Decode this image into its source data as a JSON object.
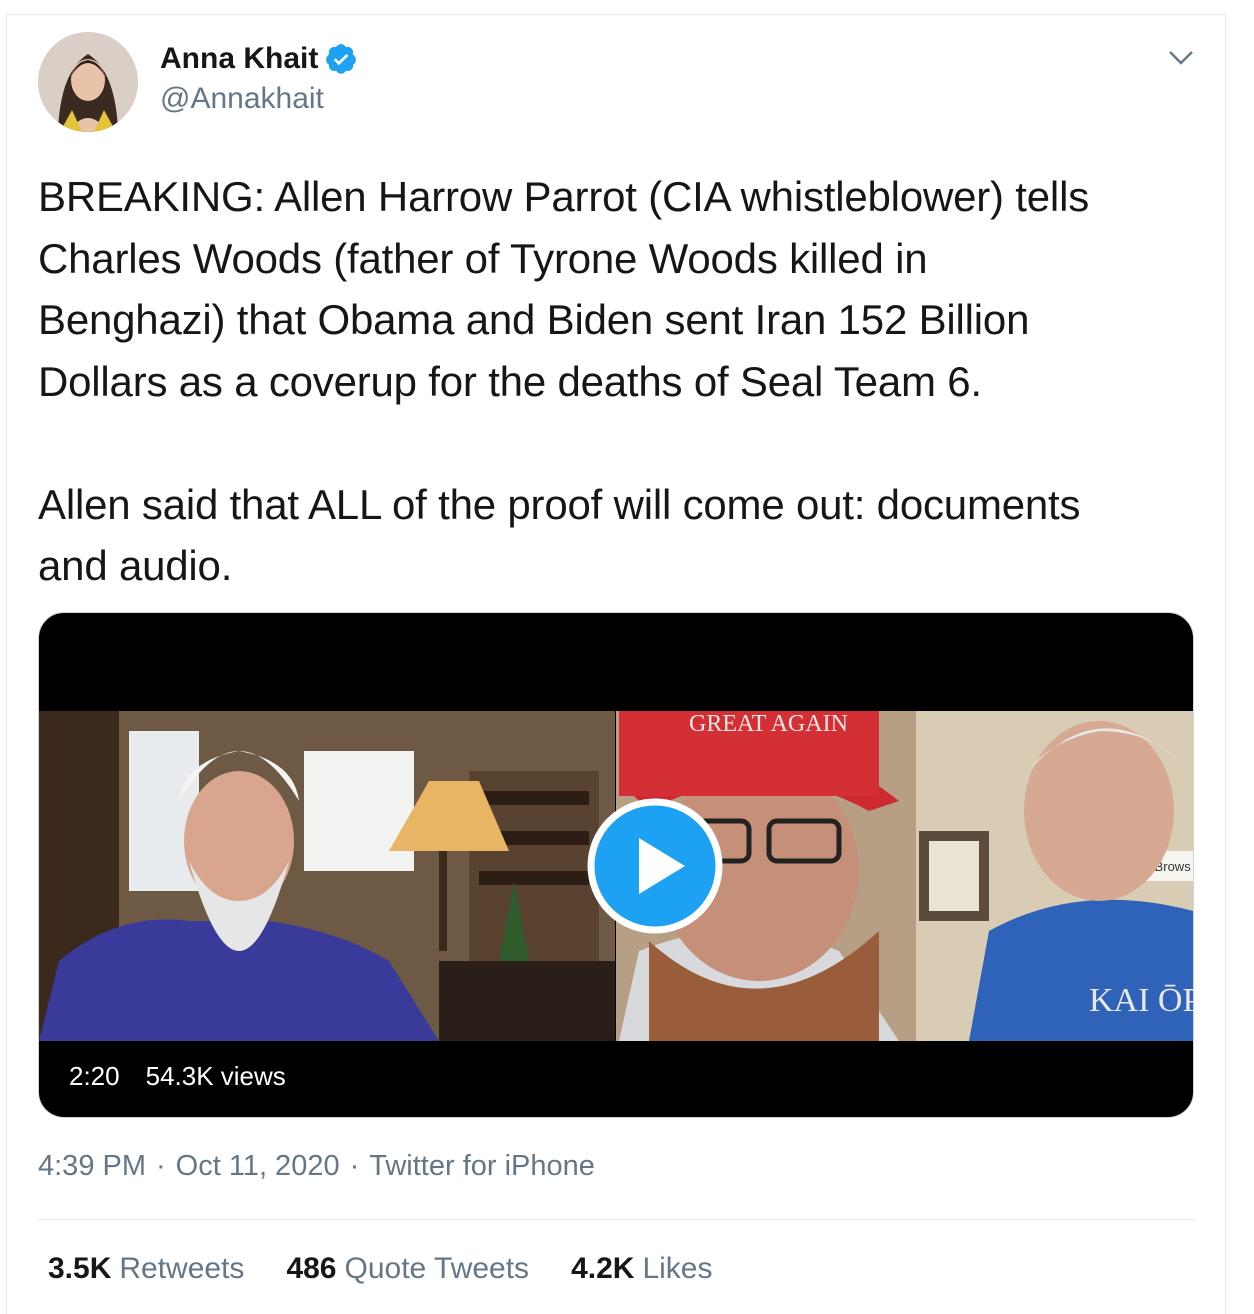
{
  "tweet": {
    "author_name": "Anna Khait",
    "author_handle": "@Annakhait",
    "verified": true,
    "text": "BREAKING: Allen Harrow Parrot (CIA whistleblower) tells\nCharles Woods (father of Tyrone Woods killed in\nBenghazi) that Obama and Biden sent Iran 152 Billion\nDollars as a coverup for the deaths of Seal Team 6.\n\nAllen said that ALL of the proof will come out: documents\nand audio."
  },
  "video": {
    "duration": "2:20",
    "views": "54.3K views",
    "overlay_cap_text": "GREAT AGAIN",
    "overlay_label": "Brave Brows",
    "overlay_shirt_text": "KAI ŌP"
  },
  "meta": {
    "time": "4:39 PM",
    "sep1": "·",
    "date": "Oct 11, 2020",
    "sep2": "·",
    "source": "Twitter for iPhone"
  },
  "stats": {
    "retweets_count": "3.5K",
    "retweets_label": "Retweets",
    "quotes_count": "486",
    "quotes_label": "Quote Tweets",
    "likes_count": "4.2K",
    "likes_label": "Likes"
  },
  "colors": {
    "accent": "#1da1f2",
    "text": "#14171a",
    "muted": "#657786"
  },
  "icons": [
    "verified-badge-icon",
    "chevron-down-icon",
    "play-icon"
  ]
}
